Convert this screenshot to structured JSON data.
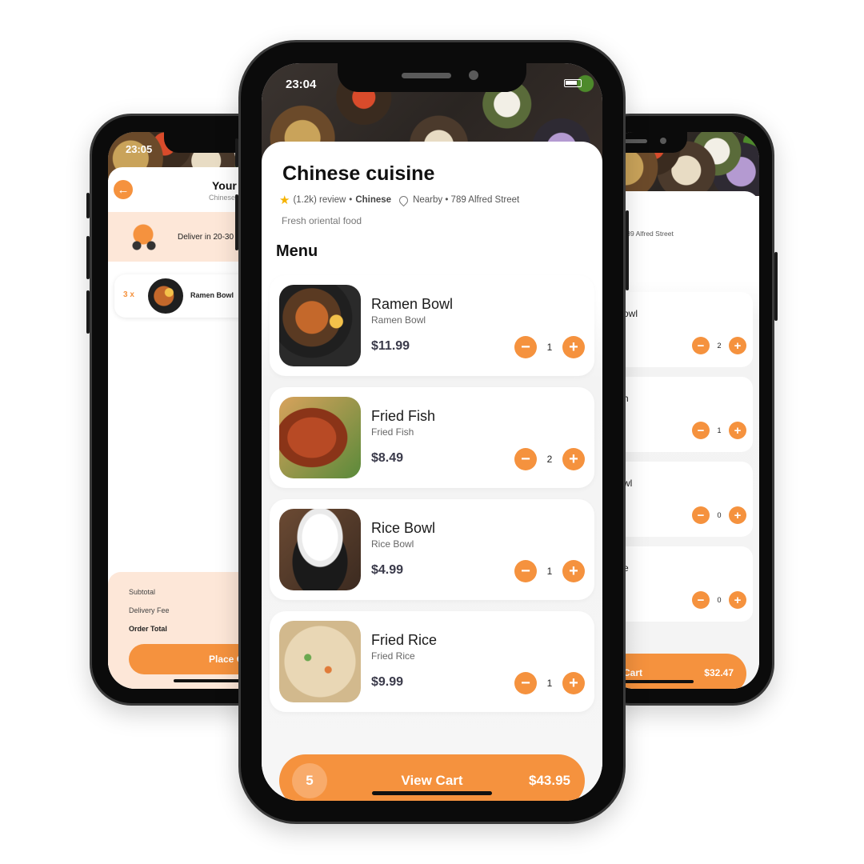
{
  "center": {
    "status_time": "23:04",
    "restaurant": {
      "name": "Chinese cuisine",
      "review": "(1.2k) review",
      "separator": "•",
      "category": "Chinese",
      "location": "Nearby • 789 Alfred Street",
      "tagline": "Fresh oriental food"
    },
    "menu_title": "Menu",
    "items": [
      {
        "name": "Ramen Bowl",
        "subtitle": "Ramen Bowl",
        "price": "$11.99",
        "qty": "1"
      },
      {
        "name": "Fried Fish",
        "subtitle": "Fried Fish",
        "price": "$8.49",
        "qty": "2"
      },
      {
        "name": "Rice Bowl",
        "subtitle": "Rice Bowl",
        "price": "$4.99",
        "qty": "1"
      },
      {
        "name": "Fried Rice",
        "subtitle": "Fried Rice",
        "price": "$9.99",
        "qty": "1"
      }
    ],
    "cart": {
      "count": "5",
      "label": "View Cart",
      "total": "$43.95"
    }
  },
  "left": {
    "status_time": "23:05",
    "title": "Your",
    "subtitle": "Chinese",
    "deliver_text": "Deliver in 20-30",
    "cart_item": {
      "qty": "3 x",
      "name": "Ramen Bowl"
    },
    "summary": {
      "subtotal_label": "Subtotal",
      "delivery_label": "Delivery Fee",
      "total_label": "Order Total"
    },
    "place_label": "Place O"
  },
  "right": {
    "title": "e",
    "meta": "rby • 789 Alfred Street",
    "items": [
      {
        "name": "owl",
        "qty": "2"
      },
      {
        "name": "h",
        "qty": "1"
      },
      {
        "name": "wl",
        "qty": "0"
      },
      {
        "name": "e",
        "qty": "0"
      }
    ],
    "cart": {
      "label": "Cart",
      "total": "$32.47"
    }
  },
  "icons": {
    "qty_minus": "−",
    "qty_plus": "+",
    "back": "←",
    "star": "★"
  },
  "colors": {
    "accent": "#f5923e",
    "accent_light": "#fde7d8",
    "text_dark": "#111111"
  }
}
